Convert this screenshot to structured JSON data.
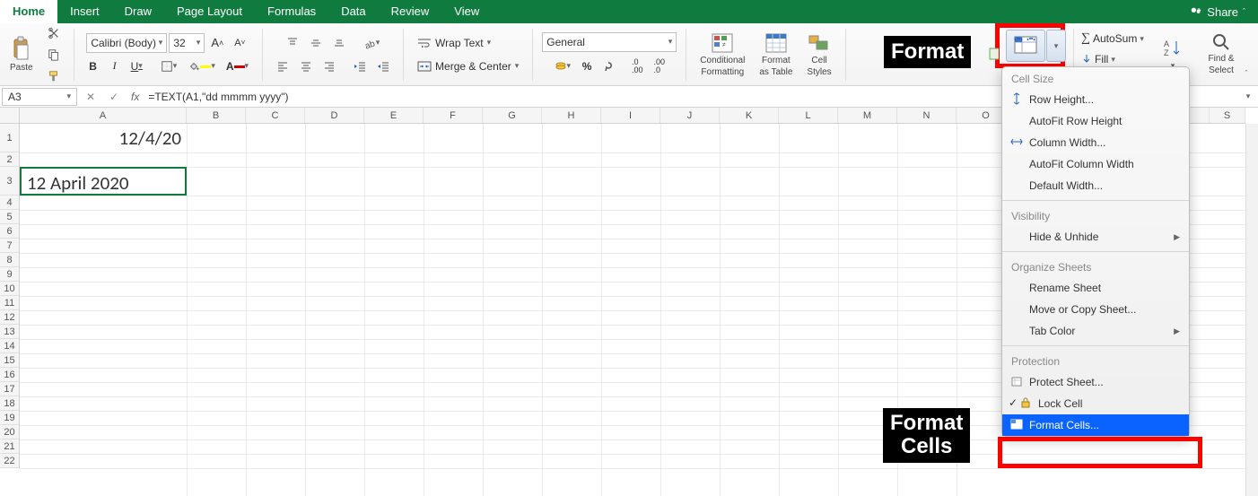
{
  "menubar": {
    "tabs": [
      "Home",
      "Insert",
      "Draw",
      "Page Layout",
      "Formulas",
      "Data",
      "Review",
      "View"
    ],
    "active": "Home",
    "share": "Share"
  },
  "ribbon": {
    "paste": "Paste",
    "font_name": "Calibri (Body)",
    "font_size": "32",
    "wrap_text": "Wrap Text",
    "merge_center": "Merge & Center",
    "number_format": "General",
    "cond_fmt_l1": "Conditional",
    "cond_fmt_l2": "Formatting",
    "fmt_table_l1": "Format",
    "fmt_table_l2": "as Table",
    "cell_styles_l1": "Cell",
    "cell_styles_l2": "Styles",
    "autosum": "AutoSum",
    "fill": "Fill",
    "find_select_l1": "Find &",
    "find_select_l2": "Select",
    "az_sort": "A\nZ"
  },
  "annotation": {
    "format": "Format",
    "format_cells": "Format\nCells"
  },
  "fbar": {
    "cellref": "A3",
    "formula": "=TEXT(A1,\"dd mmmm yyyy\")"
  },
  "cells": {
    "a1": "12/4/20",
    "a3": "12 April 2020"
  },
  "cols": [
    "A",
    "B",
    "C",
    "D",
    "E",
    "F",
    "G",
    "H",
    "I",
    "J",
    "K",
    "L",
    "M",
    "N",
    "O",
    "S"
  ],
  "rows": [
    "1",
    "2",
    "3",
    "4",
    "5",
    "6",
    "7",
    "8",
    "9",
    "10",
    "11",
    "12",
    "13",
    "14",
    "15",
    "16",
    "17",
    "18",
    "19",
    "20",
    "21",
    "22"
  ],
  "menu": {
    "section1_title": "Cell Size",
    "rowheight": "Row Height...",
    "autofit_row": "AutoFit Row Height",
    "colwidth": "Column Width...",
    "autofit_col": "AutoFit Column Width",
    "default_width": "Default Width...",
    "section2_title": "Visibility",
    "hide_unhide": "Hide & Unhide",
    "section3_title": "Organize Sheets",
    "rename": "Rename Sheet",
    "move_copy": "Move or Copy Sheet...",
    "tab_color": "Tab Color",
    "section4_title": "Protection",
    "protect": "Protect Sheet...",
    "lock": "Lock Cell",
    "format_cells": "Format Cells..."
  }
}
